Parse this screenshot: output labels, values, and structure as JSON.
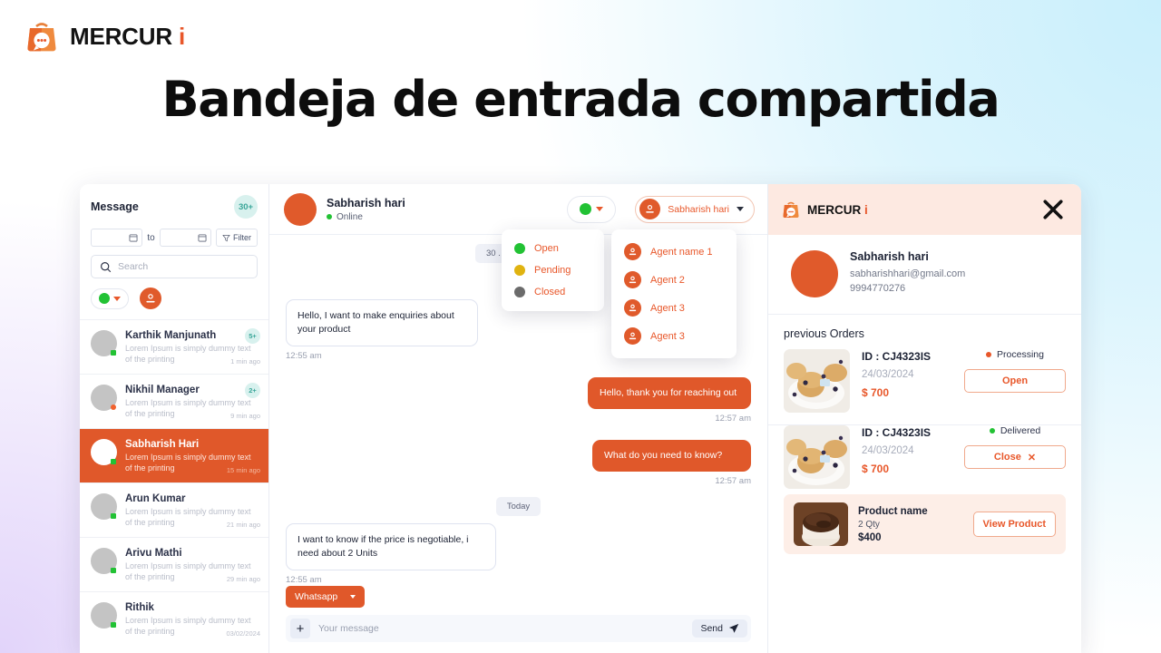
{
  "brand": {
    "name": "MERCUR",
    "accent_letter": "i",
    "icon": "shopping-bag-chat-icon"
  },
  "page": {
    "title": "Bandeja de entrada compartida"
  },
  "colors": {
    "primary": "#e0582a",
    "primary_text": "#e8572a",
    "green": "#22c234",
    "yellow": "#e0b310",
    "grey": "#6b6b6b",
    "teal_badge_bg": "#d8f1ee",
    "teal_badge_text": "#3aa699",
    "panel_header_bg": "#fde9e1"
  },
  "sidebar": {
    "title": "Message",
    "count_badge": "30+",
    "date_from_value": "",
    "date_to_label": "to",
    "date_to_value": "",
    "filter_label": "Filter",
    "search_placeholder": "Search",
    "status_filter_value": "online",
    "conversations": [
      {
        "name": "Karthik Manjunath",
        "preview_line1": "Lorem Ipsum is simply dummy text",
        "preview_line2": "of the printing",
        "time": "1 min ago",
        "badge": "5+",
        "presence": "green",
        "active": false
      },
      {
        "name": "Nikhil Manager",
        "preview_line1": "Lorem Ipsum is simply dummy text",
        "preview_line2": "of the printing",
        "time": "9 min ago",
        "badge": "2+",
        "presence": "orange",
        "active": false
      },
      {
        "name": "Sabharish Hari",
        "preview_line1": "Lorem Ipsum is simply dummy text",
        "preview_line2": "of the printing",
        "time": "15 min ago",
        "badge": "",
        "presence": "green",
        "active": true
      },
      {
        "name": "Arun Kumar",
        "preview_line1": "Lorem Ipsum is simply dummy text",
        "preview_line2": "of the printing",
        "time": "21 min ago",
        "badge": "",
        "presence": "green",
        "active": false
      },
      {
        "name": "Arivu Mathi",
        "preview_line1": "Lorem Ipsum is simply dummy text",
        "preview_line2": "of the printing",
        "time": "29 min ago",
        "badge": "",
        "presence": "green",
        "active": false
      },
      {
        "name": "Rithik",
        "preview_line1": "Lorem Ipsum is simply dummy text",
        "preview_line2": "of the printing",
        "time": "03/02/2024",
        "badge": "",
        "presence": "green",
        "active": false
      }
    ]
  },
  "chat": {
    "header": {
      "contact_name": "Sabharish hari",
      "status": "Online",
      "status_pill_value": "open",
      "agent_pill_value": "Sabharish hari"
    },
    "status_dropdown": {
      "items": [
        {
          "label": "Open",
          "color": "#22c234"
        },
        {
          "label": "Pending",
          "color": "#e0b310"
        },
        {
          "label": "Closed",
          "color": "#6b6b6b"
        }
      ]
    },
    "agent_dropdown": {
      "items": [
        {
          "label": "Agent name 1"
        },
        {
          "label": "Agent 2"
        },
        {
          "label": "Agent 3"
        },
        {
          "label": "Agent 3"
        }
      ]
    },
    "date_chip_partial": "30 .",
    "day_chip": "Today",
    "messages": [
      {
        "side": "in",
        "text": "Hello, I want to make enquiries about your product",
        "time": "12:55 am"
      },
      {
        "side": "out",
        "text": "Hello, thank you for reaching out",
        "time": "12:57 am"
      },
      {
        "side": "out",
        "text": "What do you need to know?",
        "time": "12:57 am"
      },
      {
        "side": "in",
        "text": "I want to know if the price is negotiable, i need about 2 Units",
        "time": "12:55 am"
      }
    ],
    "composer": {
      "channel_label": "Whatsapp",
      "add_label": "+",
      "input_placeholder": "Your message",
      "send_label": "Send"
    }
  },
  "panel": {
    "close_label": "✕",
    "contact": {
      "name": "Sabharish hari",
      "email": "sabharishhari@gmail.com",
      "phone": "9994770276"
    },
    "orders_title": "previous Orders",
    "orders": [
      {
        "id": "ID : CJ4323IS",
        "date": "24/03/2024",
        "price": "$ 700",
        "status": "Processing",
        "status_color": "#e8572a",
        "action_label": "Open",
        "action_icon": ""
      },
      {
        "id": "ID : CJ4323IS",
        "date": "24/03/2024",
        "price": "$ 700",
        "status": "Delivered",
        "status_color": "#22c234",
        "action_label": "Close",
        "action_icon": "✕"
      }
    ],
    "product": {
      "name": "Product name",
      "qty": "2 Qty",
      "price": "$400",
      "button_label": "View Product"
    }
  }
}
